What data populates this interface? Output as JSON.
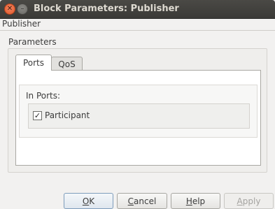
{
  "window": {
    "title": "Block Parameters: Publisher"
  },
  "block_name": "Publisher",
  "parameters_label": "Parameters",
  "tabs": [
    {
      "label": "Ports",
      "active": true
    },
    {
      "label": "QoS",
      "active": false
    }
  ],
  "ports_tab": {
    "in_ports_label": "In Ports:",
    "participant": {
      "label": "Participant",
      "checked": true,
      "check_glyph": "✓"
    }
  },
  "buttons": {
    "ok": "OK",
    "cancel": "Cancel",
    "help": "Help",
    "apply": "Apply"
  },
  "colors": {
    "titlebar": "#3b3a37",
    "close_button": "#e05a2b",
    "dialog_bg": "#f2f1f0"
  }
}
